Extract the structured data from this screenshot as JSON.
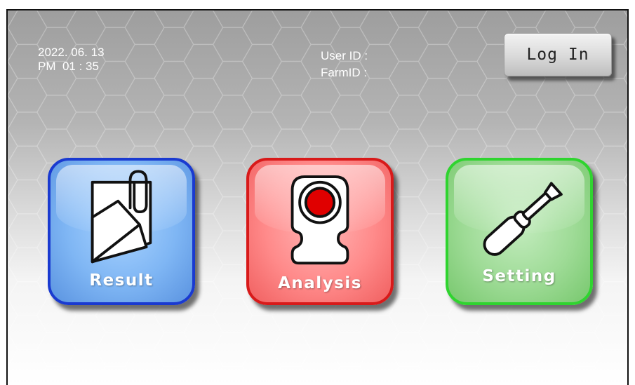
{
  "header": {
    "date": "2022. 06. 13",
    "time": "PM  01 : 35",
    "user_id_label": "User ID :",
    "farm_id_label": "FarmID :",
    "login_label": "Log In"
  },
  "tiles": [
    {
      "label": "Result",
      "icon": "document-clip-icon",
      "color": "#7fb6f4",
      "border": "#1a3ad0"
    },
    {
      "label": "Analysis",
      "icon": "sample-cartridge-icon",
      "color": "#ff8a8a",
      "border": "#d81a1a"
    },
    {
      "label": "Setting",
      "icon": "screwdriver-icon",
      "color": "#9edb96",
      "border": "#2fd42f"
    }
  ]
}
